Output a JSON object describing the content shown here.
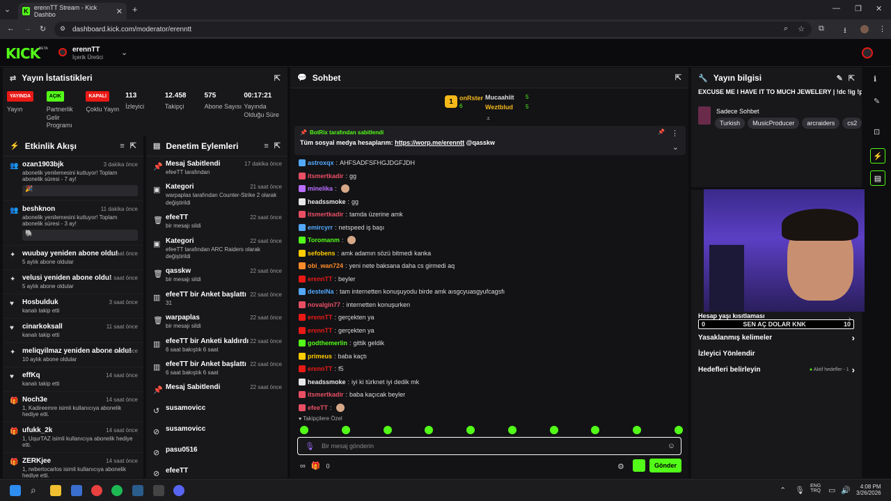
{
  "browser": {
    "tab_title": "erennTT Stream - Kick Dashbo",
    "url": "dashboard.kick.com/moderator/erenntt"
  },
  "kick": {
    "logo": "KICK",
    "beta": "BETA",
    "user_name": "erennTT",
    "user_role": "İçerik Üretici"
  },
  "stats": {
    "title": "Yayın İstatistikleri",
    "items": [
      {
        "badge": "YAYINDA",
        "badge_color": "#e91916",
        "label": "Yayın"
      },
      {
        "badge": "AÇIK",
        "badge_color": "#53fc18",
        "label": "Partnerlik Gelir Programı"
      },
      {
        "badge": "KAPALI",
        "badge_color": "#e91916",
        "label": "Çoklu Yayın"
      },
      {
        "value": "113",
        "label": "İzleyici"
      },
      {
        "value": "12.458",
        "label": "Takipçi"
      },
      {
        "value": "575",
        "label": "Abone Sayısı"
      },
      {
        "value": "00:17:21",
        "label": "Yayında Olduğu Süre"
      }
    ]
  },
  "activity": {
    "title": "Etkinlik Akışı",
    "items": [
      {
        "user": "ozan1903bjk",
        "time": "3 dakika önce",
        "desc": "abonelik yenilemesini kutluyor! Toplam abonelik süresi - 7 ay!",
        "box": "🎉"
      },
      {
        "user": "beshknon",
        "time": "11 dakika önce",
        "desc": "abonelik yenilemesini kutluyor! Toplam abonelik süresi - 3 ay!",
        "box": "🐘"
      },
      {
        "user": "wuubay yeniden abone oldu!",
        "time": "1 saat önce",
        "desc": "5 aylık abone oldular"
      },
      {
        "user": "velusi yeniden abone oldu!",
        "time": "1 saat önce",
        "desc": "5 aylık abone oldular"
      },
      {
        "user": "Hosbulduk",
        "time": "3 saat önce",
        "desc": "kanalı takip etti"
      },
      {
        "user": "cinarkoksall",
        "time": "11 saat önce",
        "desc": "kanalı takip etti"
      },
      {
        "user": "meliqyilmaz yeniden abone oldu!",
        "time": "12 saat önce",
        "desc": "10 aylık abone oldular"
      },
      {
        "user": "effKq",
        "time": "14 saat önce",
        "desc": "kanalı takip etti"
      },
      {
        "user": "Noch3e",
        "time": "14 saat önce",
        "desc": "1, Kadireemre isimli kullanıcıya abonelik hediye etti."
      },
      {
        "user": "ufukk_2k",
        "time": "14 saat önce",
        "desc": "1, UqurTAZ isimli kullanıcıya abonelik hediye etti."
      },
      {
        "user": "ZERKjee",
        "time": "14 saat önce",
        "desc": "1, rwbertocarlos isimli kullanıcıya abonelik hediye etti."
      }
    ]
  },
  "modlog": {
    "title": "Denetim Eylemleri",
    "items": [
      {
        "title": "Mesaj Sabitlendi",
        "time": "17 dakika önce",
        "desc": "efeeTT tarafından"
      },
      {
        "title": "Kategori",
        "time": "21 saat önce",
        "desc": "warpaplas tarafından Counter-Strike 2 olarak değiştirildi"
      },
      {
        "title": "efeeTT",
        "time": "22 saat önce",
        "desc": "bir mesajı sildi"
      },
      {
        "title": "Kategori",
        "time": "22 saat önce",
        "desc": "efeeTT tarafından ARC Raiders olarak değiştirildi"
      },
      {
        "title": "qasskw",
        "time": "22 saat önce",
        "desc": "bir mesajı sildi"
      },
      {
        "title": "efeeTT bir Anket başlattı",
        "time": "22 saat önce",
        "desc": "31"
      },
      {
        "title": "warpaplas",
        "time": "22 saat önce",
        "desc": "bir mesajı sildi"
      },
      {
        "title": "efeeTT bir Anketi kaldırdı",
        "time": "22 saat önce",
        "desc": "6 saat bakıştık 6 saat"
      },
      {
        "title": "efeeTT bir Anket başlattı",
        "time": "22 saat önce",
        "desc": "6 saat bakıştık 6 saat"
      },
      {
        "title": "Mesaj Sabitlendi",
        "time": "22 saat önce",
        "desc": ""
      },
      {
        "title": "susamovicc",
        "time": "",
        "desc": ""
      },
      {
        "title": "susamovicc",
        "time": "",
        "desc": ""
      },
      {
        "title": "pasu0516",
        "time": "",
        "desc": ""
      },
      {
        "title": "efeeTT",
        "time": "",
        "desc": ""
      }
    ]
  },
  "chat": {
    "title": "Sohbet",
    "top": [
      {
        "name": "onRster",
        "count": "6"
      },
      {
        "name": "Mucaahiit",
        "count": "5"
      },
      {
        "name": "Weztblud",
        "count": "5"
      }
    ],
    "pinned_by": "BotRix tarafından sabitlendi",
    "pinned_text": "Tüm sosyal medya hesaplarım:",
    "pinned_link": "https://worp.me/erenntt",
    "pinned_mention": "@qasskw",
    "messages": [
      {
        "u": "astroxqx",
        "c": "#53a8fc",
        "t": "AHFSADFSFHGJDGFJDH"
      },
      {
        "u": "itsmertkadir",
        "c": "#e94f64",
        "t": "gg"
      },
      {
        "u": "minelika",
        "c": "#b96dff",
        "t": ""
      },
      {
        "u": "headssmoke",
        "c": "#e8e8e8",
        "t": "gg"
      },
      {
        "u": "itsmertkadir",
        "c": "#e94f64",
        "t": "tamda üzerine amk"
      },
      {
        "u": "emircyrr",
        "c": "#53a8fc",
        "t": "netspeed iş başı"
      },
      {
        "u": "Toromanm",
        "c": "#53fc18",
        "t": ""
      },
      {
        "u": "sefobens",
        "c": "#ffcc00",
        "t": "amk adamın sözü bitmedi kanka"
      },
      {
        "u": "obi_wan724",
        "c": "#ff8c2a",
        "t": "yeni nete baksana daha cs girmedi aq"
      },
      {
        "u": "erennTT",
        "c": "#e91916",
        "t": "beyler"
      },
      {
        "u": "desteiNa",
        "c": "#53a8fc",
        "t": "tam internetten konuşuyodu birde amk aısgcyuasgyufcagsfı"
      },
      {
        "u": "novalgin77",
        "c": "#e94f64",
        "t": "internetten konuşurken"
      },
      {
        "u": "erennTT",
        "c": "#e91916",
        "t": "gerçekten ya"
      },
      {
        "u": "erennTT",
        "c": "#e91916",
        "t": "gerçekten ya"
      },
      {
        "u": "godthemerlin",
        "c": "#53fc18",
        "t": "gittik geldik"
      },
      {
        "u": "primeus",
        "c": "#ffcc00",
        "t": "baba kaçtı"
      },
      {
        "u": "erennTT",
        "c": "#e91916",
        "t": "f5"
      },
      {
        "u": "headssmoke",
        "c": "#e8e8e8",
        "t": "iyi ki türknet iyi dedik mk"
      },
      {
        "u": "itsmertkadir",
        "c": "#e94f64",
        "t": "baba kaçıcak beyler"
      },
      {
        "u": "efeeTT",
        "c": "#e94f64",
        "t": ""
      }
    ],
    "followers_only": "Takipçilere Özel",
    "placeholder": "Bir mesaj gönderin",
    "send": "Gönder",
    "counter1": "0",
    "counter2": "0"
  },
  "info": {
    "title": "Yayın bilgisi",
    "stream_title": "EXCUSE ME I HAVE IT TO MUCH JEWELERY | !dc !ig !pl",
    "category": "Sadece Sohbet",
    "tags": [
      "Turkish",
      "MusicProducer",
      "arcraiders",
      "cs2"
    ],
    "goal_label": "SEN AÇ DOLAR KNK",
    "goal_start": "0",
    "goal_end": "10",
    "rows": [
      "Hesap yaşı kısıtlaması",
      "Yasaklanmış kelimeler",
      "İzleyici Yönlendir",
      "Hedefleri belirleyin"
    ],
    "active_goals": "Aktif hedefler - 1"
  },
  "clock": {
    "time": "4:08 PM",
    "date": "3/26/2026",
    "lang1": "ENG",
    "lang2": "TRQ"
  }
}
